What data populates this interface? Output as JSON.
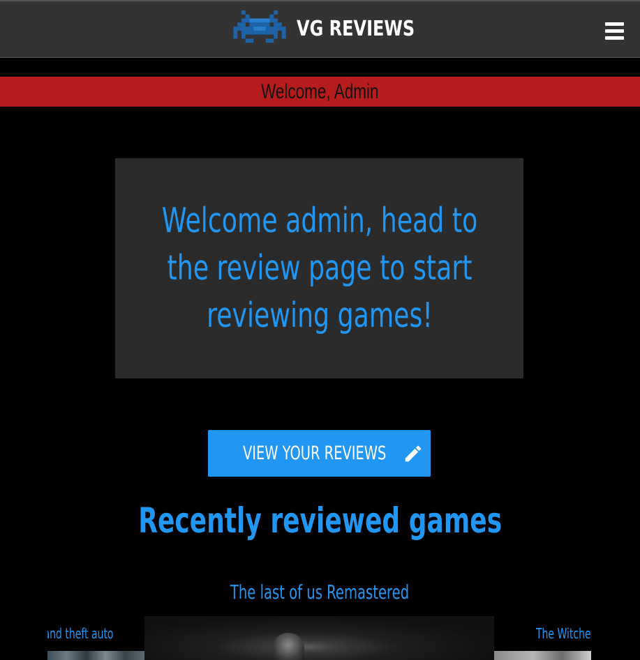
{
  "navbar": {
    "brand_text": "VG REVIEWS",
    "logo_icon": "space-invader-icon",
    "menu_icon": "hamburger-menu-icon"
  },
  "welcome_bar": {
    "text": "Welcome, Admin"
  },
  "hero": {
    "message": "Welcome admin, head to the review page to start reviewing games!"
  },
  "actions": {
    "view_reviews_label": "VIEW YOUR REVIEWS",
    "view_reviews_icon": "pencil-icon"
  },
  "recent": {
    "title": "Recently reviewed games",
    "carousel": {
      "current_title": "The last of us Remastered",
      "prev_title": "Grand theft auto",
      "next_title": "The Witcher"
    }
  },
  "colors": {
    "accent": "#2196f3",
    "banner": "#b71c1c",
    "navbar": "#333333",
    "panel": "#2b2b2b",
    "background": "#000000"
  }
}
